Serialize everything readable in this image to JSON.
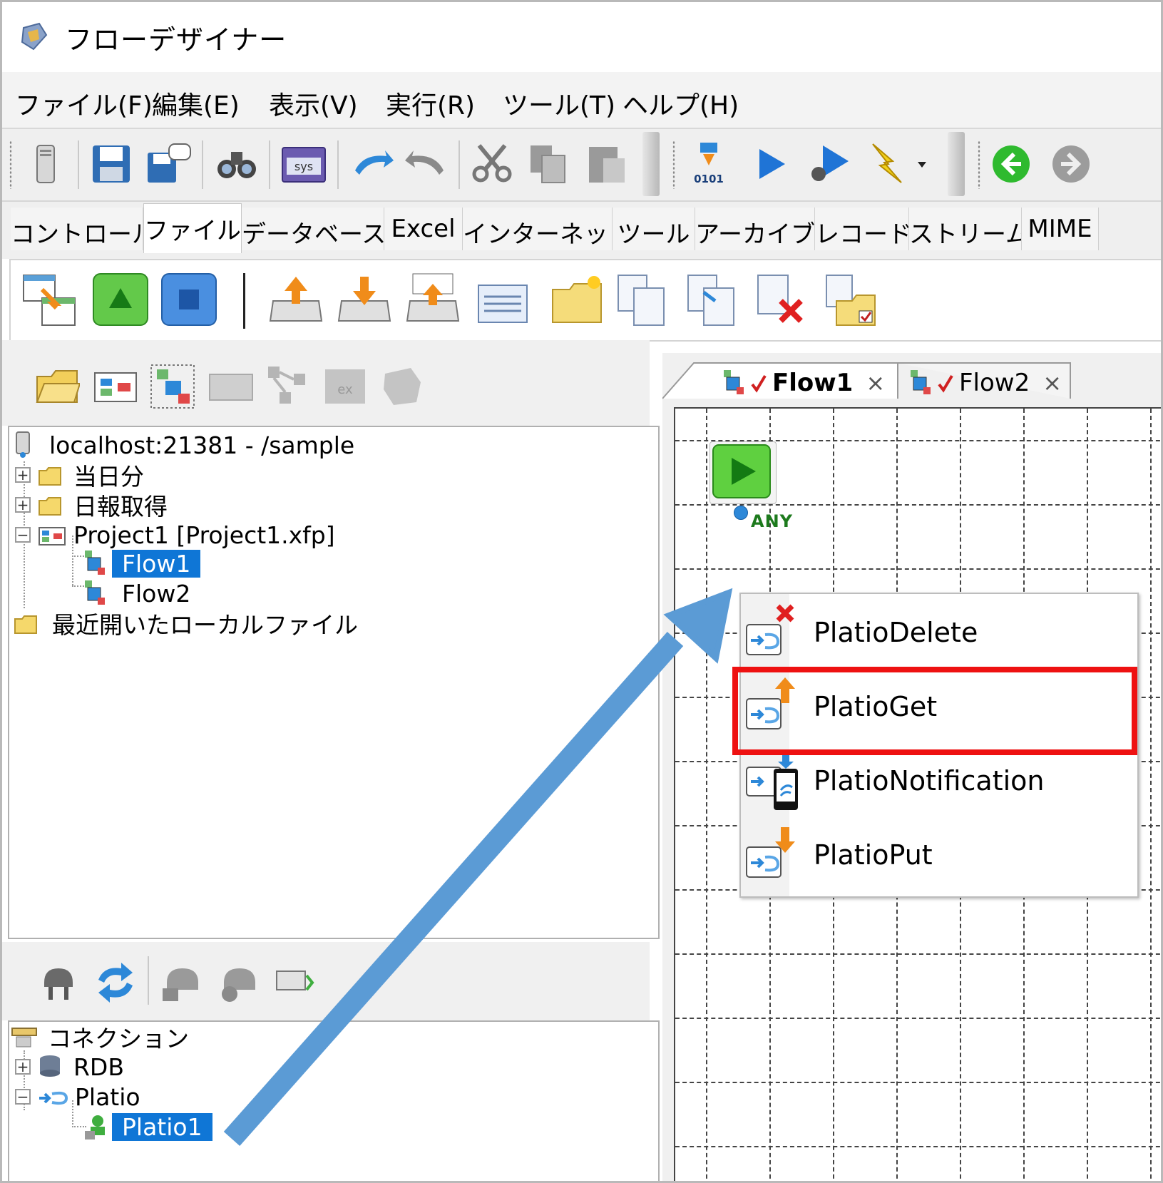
{
  "window": {
    "title": "フローデザイナー"
  },
  "menu": [
    "ファイル(F)",
    "編集(E)",
    "表示(V)",
    "実行(R)",
    "ツール(T)",
    "ヘルプ(H)"
  ],
  "component_tabs": [
    "コントロール",
    "ファイル",
    "データベース",
    "Excel",
    "インターネット",
    "ツール",
    "アーカイブ",
    "レコード",
    "ストリーム",
    "MIME"
  ],
  "component_tabs_active": "ファイル",
  "tree": {
    "server": "localhost:21381 - /sample",
    "folder1": "当日分",
    "folder2": "日報取得",
    "project": "Project1 [Project1.xfp]",
    "flow1": "Flow1",
    "flow2": "Flow2",
    "recent": "最近開いたローカルファイル"
  },
  "connections": {
    "root": "コネクション",
    "rdb": "RDB",
    "platio": "Platio",
    "platio1": "Platio1"
  },
  "flow_tabs": [
    {
      "label": "Flow1",
      "close": "×",
      "active": true
    },
    {
      "label": "Flow2",
      "close": "×",
      "active": false
    }
  ],
  "canvas": {
    "start_port_label": "ANY"
  },
  "popup_menu": [
    "PlatioDelete",
    "PlatioGet",
    "PlatioNotification",
    "PlatioPut"
  ],
  "popup_highlighted": "PlatioGet",
  "colors": {
    "selection": "#0f76d6",
    "highlight_box": "#ee1111",
    "arrow": "#5b9bd5"
  }
}
